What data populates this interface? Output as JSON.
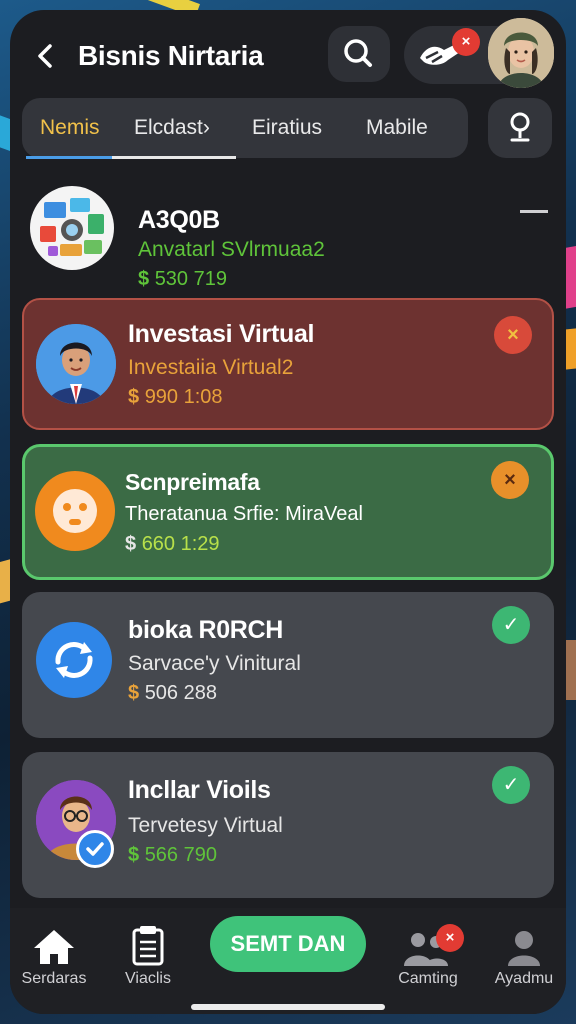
{
  "header": {
    "back_icon": "chevron-left-icon",
    "title": "Bisnis Nirtaria",
    "search_icon": "search-icon",
    "hand_icon": "handshake-icon",
    "notification_badge": "×",
    "avatar": "user-avatar"
  },
  "tabs": [
    {
      "label": "Nemis",
      "active": true
    },
    {
      "label": "Elcdast›",
      "active": false
    },
    {
      "label": "Eiratius",
      "active": false
    },
    {
      "label": "Mabile",
      "active": false
    }
  ],
  "location_icon": "location-pin-icon",
  "items": [
    {
      "title": "A3Q0B",
      "subtitle": "Anvatarl SVlrmuaa2",
      "currency": "$",
      "amount": "530 719",
      "status": "—",
      "subtitle_color": "#5fc43a",
      "amount_color": "#5fc43a",
      "icon": "media-collage-icon"
    },
    {
      "title": "Investasi Virtual",
      "subtitle": "Investaiia Virtual2",
      "currency": "$",
      "amount": "990 1:08",
      "status": "×",
      "subtitle_color": "#e8a23a",
      "amount_color": "#e8a23a",
      "icon": "businessman-avatar"
    },
    {
      "title": "Scnpreimafa",
      "subtitle": "Theratanua Srfie: MiraVeal",
      "currency": "$",
      "amount": "660 1:29",
      "status": "×",
      "subtitle_color": "#ffffff",
      "amount_color": "#b8e04a",
      "icon": "orange-face-icon"
    },
    {
      "title": "bioka R0RCH",
      "subtitle": "Sarvace'y Vinitural",
      "currency": "$",
      "amount": "506 288",
      "status": "✓",
      "subtitle_color": "#e6e6e6",
      "amount_color": "#e6e6e6",
      "icon": "sync-arrows-icon"
    },
    {
      "title": "Incllar Vioils",
      "subtitle": "Tervetesy Virtual",
      "currency": "$",
      "amount": "566 790",
      "status": "✓",
      "subtitle_color": "#e6e6e6",
      "amount_color": "#5fc43a",
      "icon": "man-glasses-avatar"
    }
  ],
  "nav": [
    {
      "label": "Serdaras",
      "icon": "home-icon"
    },
    {
      "label": "Viaclis",
      "icon": "clipboard-icon"
    },
    {
      "label": "SEMT DAN",
      "icon": ""
    },
    {
      "label": "Camting",
      "icon": "group-icon"
    },
    {
      "label": "Ayadmu",
      "icon": "person-icon"
    }
  ],
  "nav_badge": "×",
  "colors": {
    "active_tab": "#f1c14a",
    "cta": "#3fc37a",
    "red_card": "#6d3230",
    "green_card": "#3b6b45",
    "gray_card": "#45484e",
    "check": "#3db773",
    "x_badge_red": "#d84a3a",
    "x_badge_orange": "#e8902a"
  }
}
